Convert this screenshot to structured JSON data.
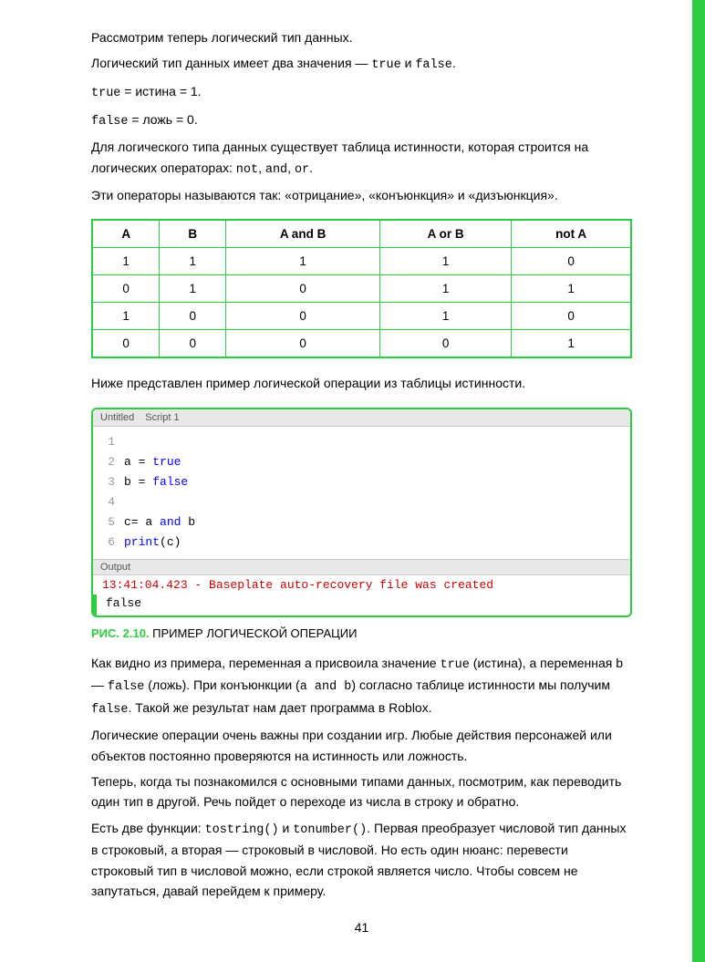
{
  "page": {
    "number": "41"
  },
  "paragraphs": [
    {
      "id": "p1",
      "text": "Рассмотрим теперь логический тип данных."
    },
    {
      "id": "p2",
      "text": "Логический тип данных имеет два значения — true и false."
    },
    {
      "id": "p3",
      "text": "true = истина = 1."
    },
    {
      "id": "p4",
      "text": "false = ложь = 0."
    },
    {
      "id": "p5",
      "text": "Для логического типа данных существует таблица истинности, которая строится на логических операторах: not, and, or."
    },
    {
      "id": "p6",
      "text": "Эти операторы называются так: «отрицание», «конъюнкция» и «дизъюнкция»."
    }
  ],
  "truth_table": {
    "headers": [
      "A",
      "B",
      "A and B",
      "A or B",
      "not A"
    ],
    "rows": [
      [
        "1",
        "1",
        "1",
        "1",
        "0"
      ],
      [
        "0",
        "1",
        "0",
        "1",
        "1"
      ],
      [
        "1",
        "0",
        "0",
        "1",
        "0"
      ],
      [
        "0",
        "0",
        "0",
        "0",
        "1"
      ]
    ]
  },
  "below_table_text": "Ниже представлен пример логической операции из таблицы истинности.",
  "code_block": {
    "titlebar_left": "Untitled",
    "titlebar_right": "Script 1",
    "lines": [
      {
        "num": "1",
        "code": ""
      },
      {
        "num": "2",
        "code": "a = true"
      },
      {
        "num": "3",
        "code": "b = false"
      },
      {
        "num": "4",
        "code": ""
      },
      {
        "num": "5",
        "code": "c= a and b"
      },
      {
        "num": "6",
        "code": "print(c)"
      }
    ],
    "output_bar": "Output",
    "output_line": "13:41:04.423 - Baseplate auto-recovery file was created",
    "output_result": "false"
  },
  "fig_caption": {
    "label": "РИС. 2.10.",
    "text": "ПРИМЕР ЛОГИЧЕСКОЙ ОПЕРАЦИИ"
  },
  "body_paragraphs": [
    {
      "id": "bp1",
      "text": "Как видно из примера, переменная a присвоила значение true (истина), а переменная b — false (ложь). При конъюнкции (a and b) согласно таблице истинности мы получим false. Такой же результат нам дает программа в Roblox."
    },
    {
      "id": "bp2",
      "text": "Логические операции очень важны при создании игр. Любые действия персонажей или объектов постоянно проверяются на истинность или ложность."
    },
    {
      "id": "bp3",
      "text": "Теперь, когда ты познакомился с основными типами данных, посмотрим, как переводить один тип в другой. Речь пойдет о переходе из числа в строку и обратно."
    },
    {
      "id": "bp4",
      "text": "Есть две функции: tostring() и tonumber(). Первая преобразует числовой тип данных в строковый, а вторая — строковый в числовой. Но есть один нюанс: перевести строковый тип в числовой можно, если строкой является число. Чтобы совсем не запутаться, давай перейдем к примеру."
    }
  ]
}
